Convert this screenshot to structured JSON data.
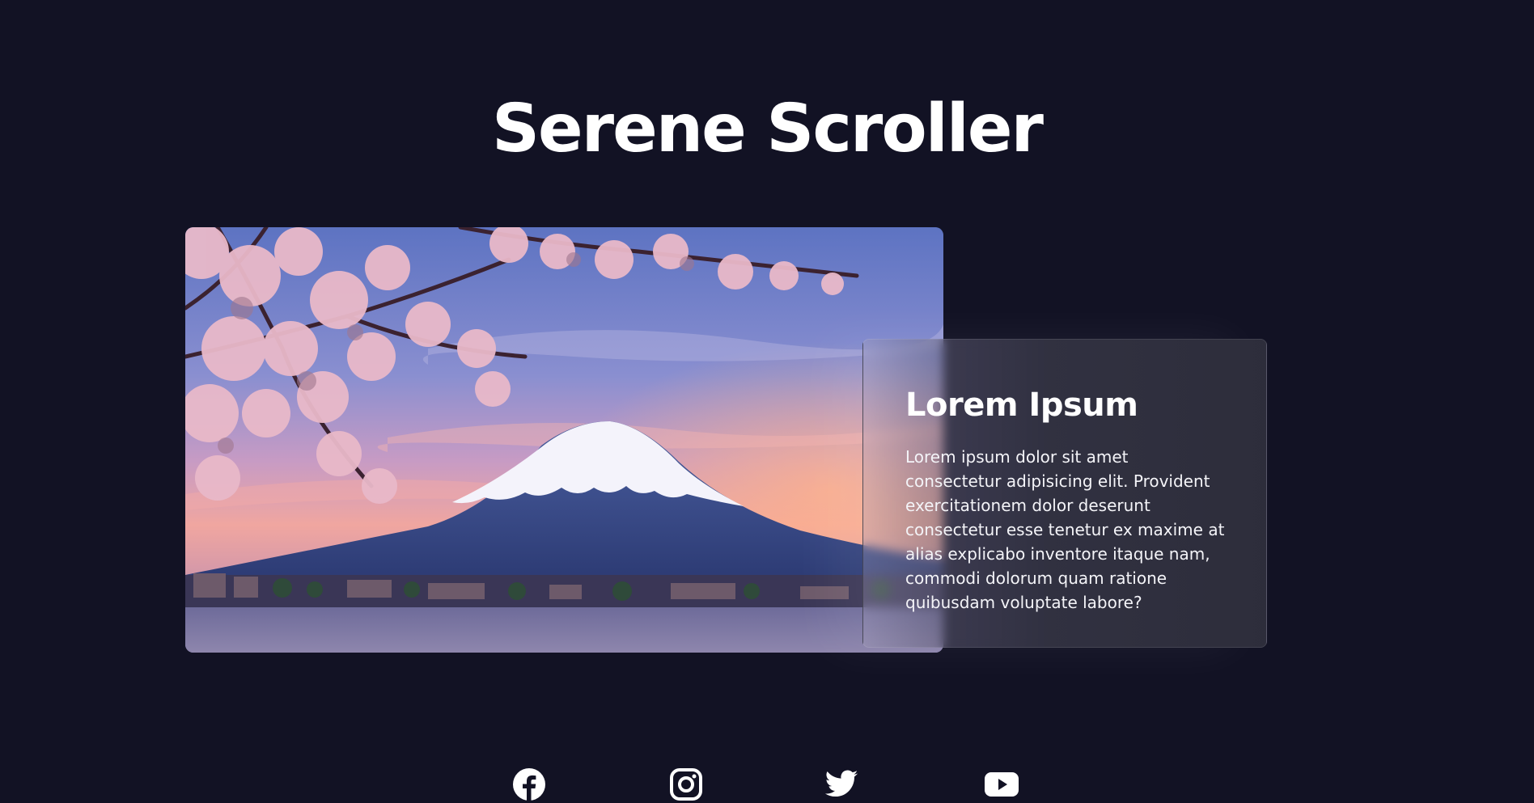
{
  "page": {
    "title": "Serene Scroller",
    "background_color": "#121224"
  },
  "hero_image": {
    "subject": "Mount Fuji with cherry blossoms at sunset"
  },
  "card": {
    "heading": "Lorem Ipsum",
    "body": "Lorem ipsum dolor sit amet consectetur adipisicing elit. Provident exercitationem dolor deserunt consectetur esse tenetur ex maxime at alias explicabo inventore itaque nam, commodi dolorum quam ratione quibusdam voluptate labore?"
  },
  "social_links": [
    {
      "icon": "facebook-icon"
    },
    {
      "icon": "instagram-icon"
    },
    {
      "icon": "twitter-icon"
    },
    {
      "icon": "youtube-icon"
    }
  ]
}
